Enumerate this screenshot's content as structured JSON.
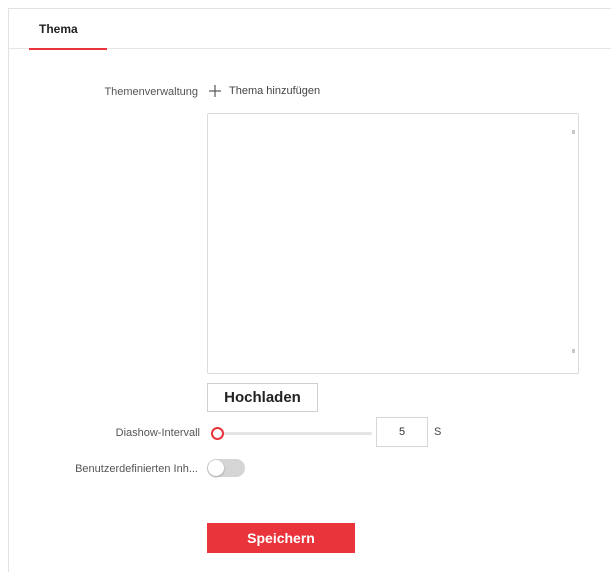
{
  "tabs": [
    {
      "label": "Thema",
      "active": true
    }
  ],
  "theme_management": {
    "label": "Themenverwaltung",
    "add_label": "Thema hinzufügen",
    "add_icon": "plus-icon"
  },
  "upload": {
    "label": "Hochladen"
  },
  "slideshow": {
    "label": "Diashow-Intervall",
    "value": "5",
    "unit": "S",
    "slider_fraction": 0.02
  },
  "custom_content": {
    "label": "Benutzerdefinierten Inh...",
    "enabled": false
  },
  "save": {
    "label": "Speichern"
  },
  "colors": {
    "accent": "#e8343a",
    "toggle_off": "#d5d5d5",
    "border": "#dcdcdc"
  }
}
